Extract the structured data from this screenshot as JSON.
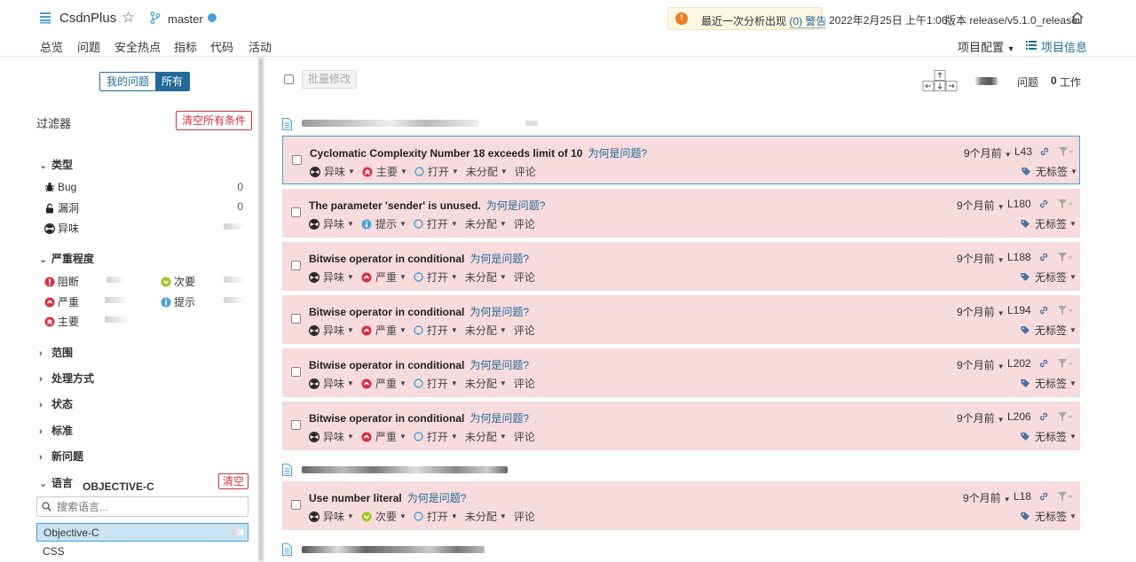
{
  "header": {
    "project_name": "CsdnPlus",
    "branch": "master",
    "alert_text": "最近一次分析出现",
    "alert_link": "(0) 警告",
    "analysis_date": "2022年2月25日 上午1:06",
    "version": "版本 release/v5.1.0_release",
    "tabs": [
      "总览",
      "问题",
      "安全热点",
      "指标",
      "代码",
      "活动"
    ],
    "active_tab": "问题",
    "project_config": "项目配置",
    "project_info": "项目信息"
  },
  "sidebar": {
    "toggle_mine": "我的问题",
    "toggle_all": "所有",
    "filter_title": "过滤器",
    "clear_all": "清空所有条件",
    "type": {
      "title": "类型",
      "items": [
        {
          "label": "Bug",
          "count": "0",
          "icon": "bug-icon"
        },
        {
          "label": "漏洞",
          "count": "0",
          "icon": "lock-icon"
        },
        {
          "label": "异味",
          "count": "",
          "icon": "code-smell-icon"
        }
      ]
    },
    "severity": {
      "title": "严重程度",
      "items": [
        {
          "label": "阻断",
          "icon": "blocker-icon"
        },
        {
          "label": "次要",
          "icon": "minor-icon"
        },
        {
          "label": "严重",
          "icon": "critical-icon"
        },
        {
          "label": "提示",
          "icon": "info-icon"
        },
        {
          "label": "主要",
          "icon": "major-icon"
        }
      ]
    },
    "collapsed_facets": [
      "范围",
      "处理方式",
      "状态",
      "标准",
      "新问题"
    ],
    "language": {
      "title": "语言",
      "selected_tag": "OBJECTIVE-C",
      "clear": "清空",
      "search_placeholder": "搜索语言...",
      "options": [
        "Objective-C",
        "CSS"
      ]
    }
  },
  "main": {
    "bulk_change": "批量修改",
    "issues_label": "问题",
    "effort_value": "0",
    "effort_label": "工作",
    "why_label": "为何是问题?",
    "type_label": "异味",
    "status_label": "打开",
    "assignee_label": "未分配",
    "comment_label": "评论",
    "tags_label": "无标签",
    "issues": [
      {
        "message": "Cyclomatic Complexity Number 18 exceeds limit of 10",
        "severity": "主要",
        "severity_icon": "major-icon",
        "age": "9个月前",
        "line": "L43",
        "selected": true
      },
      {
        "message": "The parameter 'sender' is unused.",
        "severity": "提示",
        "severity_icon": "info-icon",
        "age": "9个月前",
        "line": "L180",
        "selected": false
      },
      {
        "message": "Bitwise operator in conditional",
        "severity": "严重",
        "severity_icon": "critical-icon",
        "age": "9个月前",
        "line": "L188",
        "selected": false
      },
      {
        "message": "Bitwise operator in conditional",
        "severity": "严重",
        "severity_icon": "critical-icon",
        "age": "9个月前",
        "line": "L194",
        "selected": false
      },
      {
        "message": "Bitwise operator in conditional",
        "severity": "严重",
        "severity_icon": "critical-icon",
        "age": "9个月前",
        "line": "L202",
        "selected": false
      },
      {
        "message": "Bitwise operator in conditional",
        "severity": "严重",
        "severity_icon": "critical-icon",
        "age": "9个月前",
        "line": "L206",
        "selected": false
      },
      {
        "message": "Use number literal",
        "severity": "次要",
        "severity_icon": "minor-icon",
        "age": "9个月前",
        "line": "L18",
        "selected": false
      }
    ],
    "colors": {
      "issue_bg": "#f8dbdd",
      "link": "#236a97",
      "accent": "#4b9fd5",
      "danger": "#d4333f"
    }
  }
}
